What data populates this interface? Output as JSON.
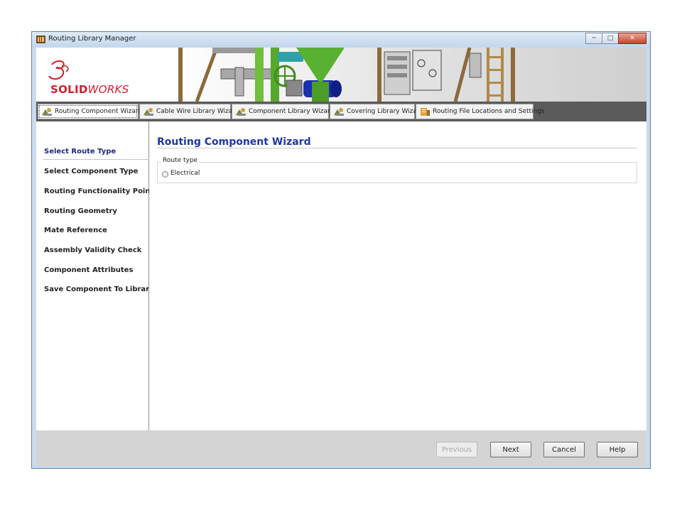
{
  "window": {
    "title": "Routing Library Manager",
    "controls": [
      "minimize",
      "maximize",
      "close"
    ]
  },
  "branding": {
    "logo_bold": "SOLID",
    "logo_italic": "WORKS"
  },
  "tabs": [
    {
      "label": "Routing Component Wizard",
      "icon": "routing-component-icon",
      "active": true
    },
    {
      "label": "Cable Wire Library Wizard",
      "icon": "cable-wire-icon",
      "active": false
    },
    {
      "label": "Component Library Wizard",
      "icon": "component-library-icon",
      "active": false
    },
    {
      "label": "Covering Library Wizard",
      "icon": "covering-library-icon",
      "active": false
    },
    {
      "label": "Routing File Locations and Settings",
      "icon": "file-locations-icon",
      "active": false
    }
  ],
  "nav": {
    "selected": "Select Route Type",
    "items": [
      "Select Route Type",
      "Select Component Type",
      "Routing Functionality Points",
      "Routing Geometry",
      "Mate Reference",
      "Assembly Validity Check",
      "Component Attributes",
      "Save Component To Library"
    ]
  },
  "main": {
    "heading": "Routing Component Wizard",
    "route_type": {
      "group_label": "Route type",
      "options": [
        {
          "label": "Electrical",
          "selected": false
        }
      ]
    }
  },
  "footer": {
    "previous": {
      "label": "Previous",
      "enabled": false
    },
    "next": {
      "label": "Next",
      "enabled": true
    },
    "cancel": {
      "label": "Cancel",
      "enabled": true
    },
    "help": {
      "label": "Help",
      "enabled": true
    }
  },
  "colors": {
    "heading": "#1f37a6",
    "logo": "#d11f2a",
    "tab_bar": "#5b5b5b",
    "footer": "#d4d4d4"
  }
}
